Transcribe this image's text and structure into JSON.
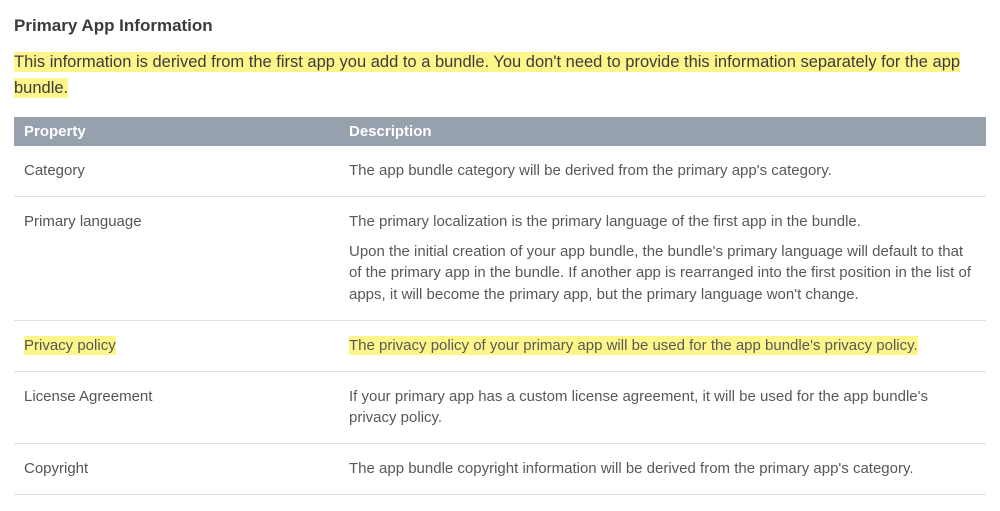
{
  "heading": "Primary App Information",
  "intro": "This information is derived from the first app you add to a bundle. You don't need to provide this information separately for the app bundle.",
  "columns": {
    "property": "Property",
    "description": "Description"
  },
  "rows": [
    {
      "property": "Category",
      "property_hl": false,
      "descriptions": [
        {
          "text": "The app bundle category will be derived from the primary app's category.",
          "hl": false
        }
      ]
    },
    {
      "property": "Primary language",
      "property_hl": false,
      "descriptions": [
        {
          "text": "The primary localization is the primary language of the first app in the bundle.",
          "hl": false
        },
        {
          "text": "Upon the initial creation of your app bundle, the bundle's primary language will default to that of the primary app in the bundle. If another app is rearranged into the first position in the list of apps, it will become the primary app, but the primary language won't change.",
          "hl": false
        }
      ]
    },
    {
      "property": "Privacy policy",
      "property_hl": true,
      "descriptions": [
        {
          "text": "The privacy policy of your primary app will be used for the app bundle's privacy policy.",
          "hl": true
        }
      ]
    },
    {
      "property": "License Agreement",
      "property_hl": false,
      "descriptions": [
        {
          "text": "If your primary app has a custom license agreement, it will be used for the app bundle's privacy policy.",
          "hl": false
        }
      ]
    },
    {
      "property": "Copyright",
      "property_hl": false,
      "descriptions": [
        {
          "text": "The app bundle copyright information will be derived from the primary app's category.",
          "hl": false
        }
      ]
    }
  ]
}
